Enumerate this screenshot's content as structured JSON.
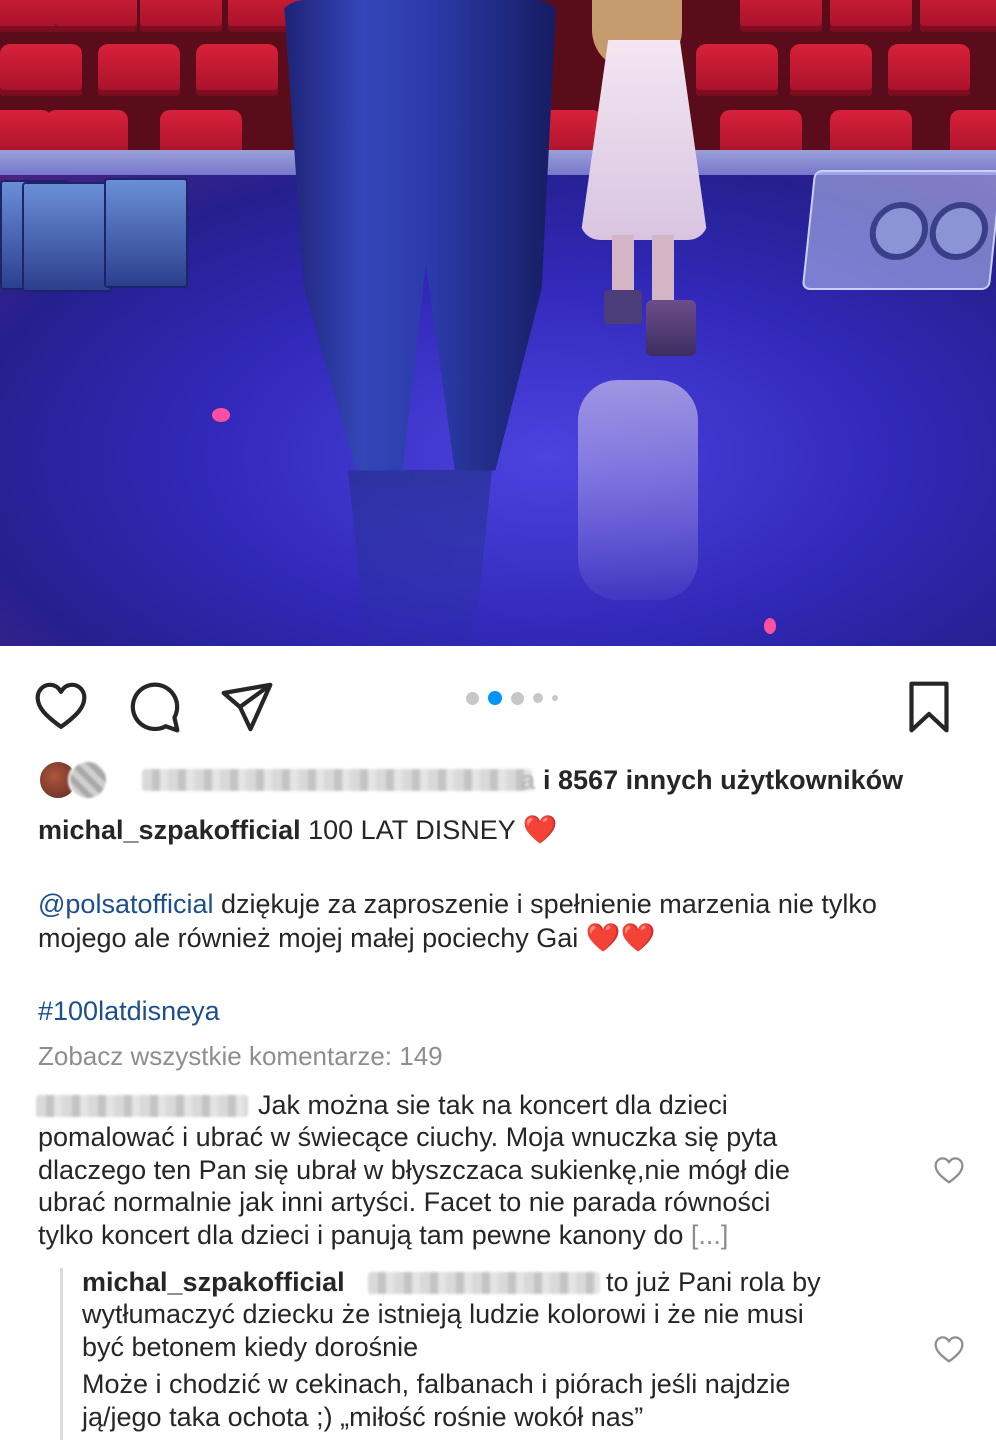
{
  "post": {
    "carousel": {
      "total": 5,
      "active": 2
    },
    "actions": {
      "like_icon": "heart-outline-icon",
      "comment_icon": "comment-bubble-icon",
      "share_icon": "paper-plane-icon",
      "save_icon": "bookmark-icon"
    },
    "likes": {
      "suffix_fragment": "a",
      "text": "i 8567 innych użytkowników"
    },
    "caption": {
      "username": "michal_szpakofficial",
      "title": "100 LAT DISNEY",
      "heart": "❤️",
      "mention": "@polsatofficial",
      "line1_rest": "dziękuje za zaproszenie i spełnienie marzenia nie tylko",
      "line2": "mojego ale również mojej małej pociechy Gai",
      "line2_hearts": "❤️❤️",
      "hashtag": "#100latdisneya"
    },
    "view_all_comments": "Zobacz wszystkie komentarze: 149",
    "comments": [
      {
        "line1": "Jak można sie tak na koncert dla dzieci",
        "line2": "pomalować i ubrać w świecące ciuchy. Moja wnuczka się pyta",
        "line3": "dlaczego ten Pan się ubrał w błyszczaca sukienkę,nie mógł die",
        "line4": "ubrać normalnie jak inni artyści. Facet to nie parada równości",
        "line5": "tylko koncert  dla dzieci i panują tam pewne kanony do",
        "more": "[...]"
      }
    ],
    "reply": {
      "username": "michal_szpakofficial",
      "line1_rest": "to już Pani rola by",
      "line2": "wytłumaczyć dziecku że istnieją ludzie kolorowi i że nie musi",
      "line3": "być betonem kiedy dorośnie",
      "line4": "Może  i chodzić w cekinach, falbanach i piórach jeśli najdzie",
      "line5": "ją/jego taka ochota ;) „miłość rośnie wokół nas”"
    },
    "colors": {
      "link": "#1c4f8e",
      "secondary_text": "#8e8e8e",
      "active_dot": "#0095f6",
      "heart": "#e0202a"
    }
  }
}
